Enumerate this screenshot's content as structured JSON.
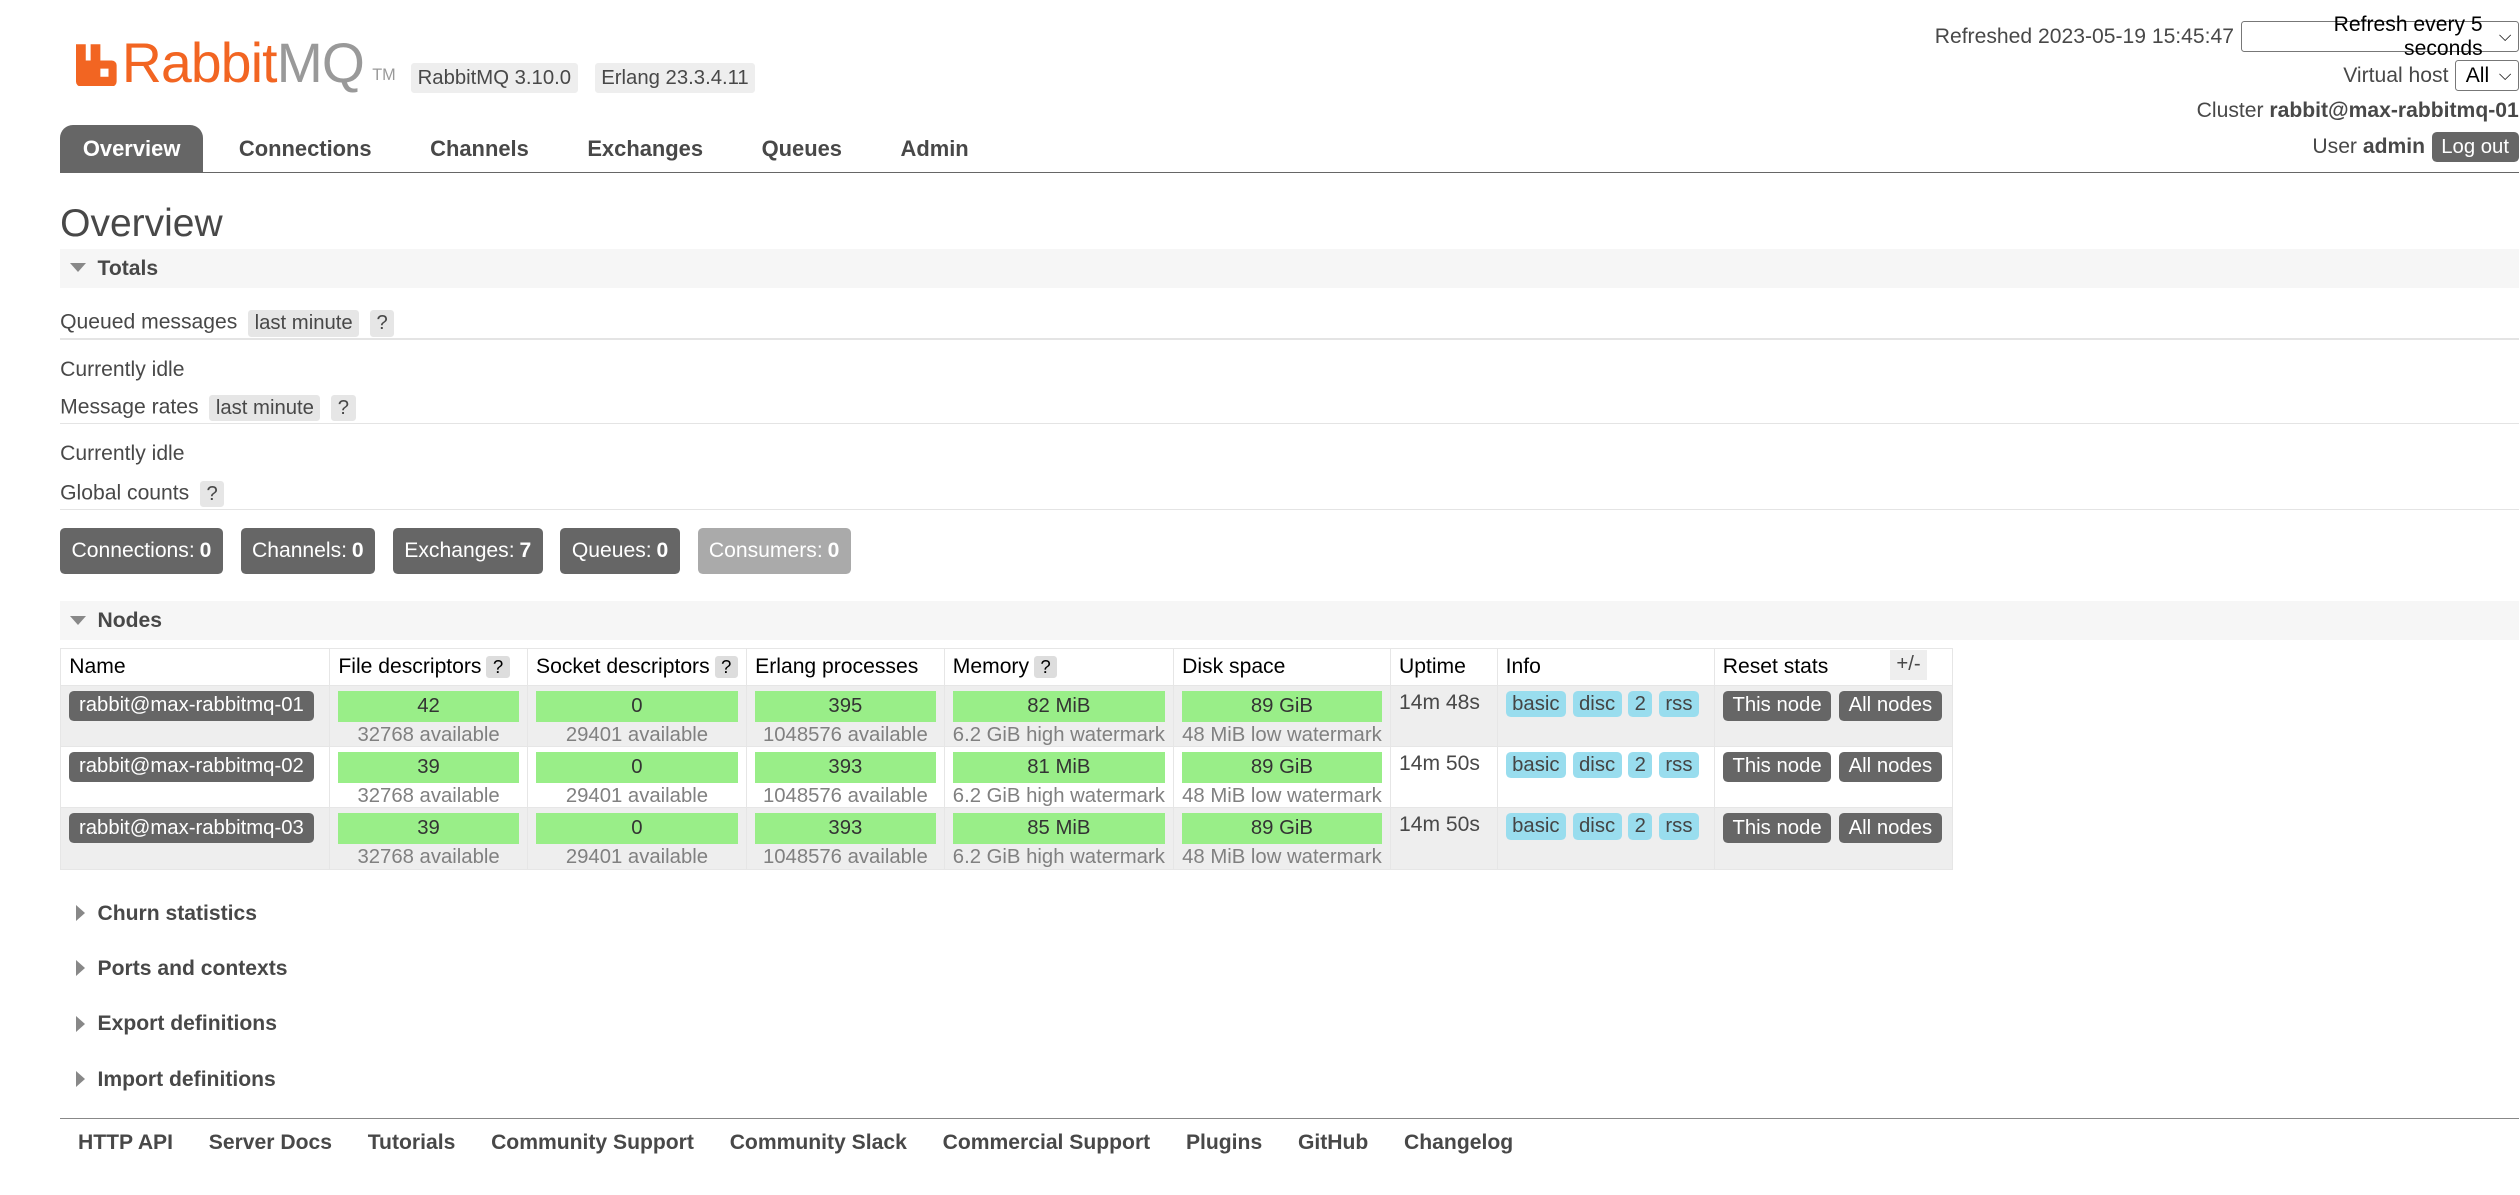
{
  "header": {
    "logo": {
      "rabbit": "Rabbit",
      "mq": "MQ",
      "tm": "TM"
    },
    "version": "RabbitMQ 3.10.0",
    "erlang": "Erlang 23.3.4.11",
    "refreshed_label": "Refreshed",
    "refreshed_time": "2023-05-19 15:45:47",
    "refresh_select": "Refresh every 5 seconds",
    "vhost_label": "Virtual host",
    "vhost_select": "All",
    "cluster_label": "Cluster",
    "cluster_name": "rabbit@max-rabbitmq-01",
    "user_label": "User",
    "user_name": "admin",
    "logout": "Log out"
  },
  "tabs": [
    "Overview",
    "Connections",
    "Channels",
    "Exchanges",
    "Queues",
    "Admin"
  ],
  "page_title": "Overview",
  "totals": {
    "section": "Totals",
    "queued_label": "Queued messages",
    "queued_range": "last minute",
    "help": "?",
    "idle1": "Currently idle",
    "rates_label": "Message rates",
    "rates_range": "last minute",
    "idle2": "Currently idle",
    "global_label": "Global counts"
  },
  "counts": [
    {
      "label": "Connections:",
      "value": "0"
    },
    {
      "label": "Channels:",
      "value": "0"
    },
    {
      "label": "Exchanges:",
      "value": "7"
    },
    {
      "label": "Queues:",
      "value": "0"
    },
    {
      "label": "Consumers:",
      "value": "0"
    }
  ],
  "nodes": {
    "section": "Nodes",
    "plusminus": "+/-",
    "columns": [
      "Name",
      "File descriptors",
      "Socket descriptors",
      "Erlang processes",
      "Memory",
      "Disk space",
      "Uptime",
      "Info",
      "Reset stats"
    ],
    "rows": [
      {
        "name": "rabbit@max-rabbitmq-01",
        "fd": "42",
        "fd_avail": "32768 available",
        "sd": "0",
        "sd_avail": "29401 available",
        "ep": "395",
        "ep_avail": "1048576 available",
        "mem": "82 MiB",
        "mem_wm": "6.2 GiB high watermark",
        "disk": "89 GiB",
        "disk_wm": "48 MiB low watermark",
        "uptime": "14m 48s",
        "info": [
          "basic",
          "disc",
          "2",
          "rss"
        ],
        "reset_this": "This node",
        "reset_all": "All nodes"
      },
      {
        "name": "rabbit@max-rabbitmq-02",
        "fd": "39",
        "fd_avail": "32768 available",
        "sd": "0",
        "sd_avail": "29401 available",
        "ep": "393",
        "ep_avail": "1048576 available",
        "mem": "81 MiB",
        "mem_wm": "6.2 GiB high watermark",
        "disk": "89 GiB",
        "disk_wm": "48 MiB low watermark",
        "uptime": "14m 50s",
        "info": [
          "basic",
          "disc",
          "2",
          "rss"
        ],
        "reset_this": "This node",
        "reset_all": "All nodes"
      },
      {
        "name": "rabbit@max-rabbitmq-03",
        "fd": "39",
        "fd_avail": "32768 available",
        "sd": "0",
        "sd_avail": "29401 available",
        "ep": "393",
        "ep_avail": "1048576 available",
        "mem": "85 MiB",
        "mem_wm": "6.2 GiB high watermark",
        "disk": "89 GiB",
        "disk_wm": "48 MiB low watermark",
        "uptime": "14m 50s",
        "info": [
          "basic",
          "disc",
          "2",
          "rss"
        ],
        "reset_this": "This node",
        "reset_all": "All nodes"
      }
    ]
  },
  "collapsed_sections": [
    "Churn statistics",
    "Ports and contexts",
    "Export definitions",
    "Import definitions"
  ],
  "footer": [
    "HTTP API",
    "Server Docs",
    "Tutorials",
    "Community Support",
    "Community Slack",
    "Commercial Support",
    "Plugins",
    "GitHub",
    "Changelog"
  ],
  "colors": {
    "brand": "#f26522",
    "bar": "#99ee88",
    "badge": "#99ddee",
    "dark": "#666666"
  },
  "icons": {
    "logo": "rabbitmq-logo-icon",
    "select": "chevron-down-icon",
    "expanded": "triangle-down-icon",
    "collapsed": "triangle-right-icon"
  }
}
